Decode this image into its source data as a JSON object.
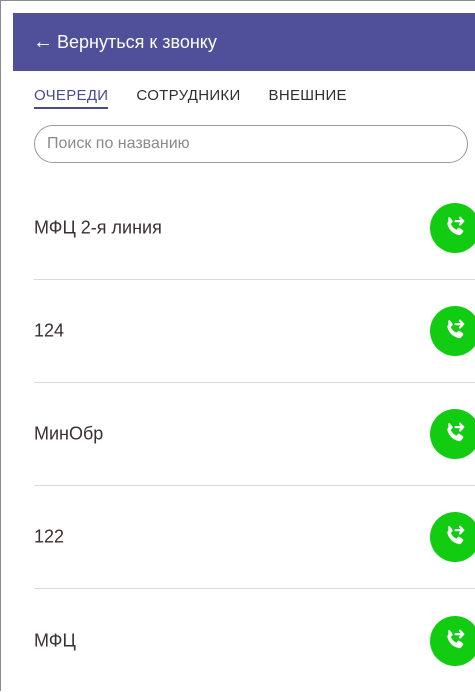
{
  "header": {
    "back_arrow": "←",
    "back_label": "Вернуться к звонку",
    "background_color": "#504f99"
  },
  "tabs": [
    {
      "label": "ОЧЕРЕДИ",
      "active": true
    },
    {
      "label": "СОТРУДНИКИ",
      "active": false
    },
    {
      "label": "ВНЕШНИЕ",
      "active": false
    }
  ],
  "search": {
    "placeholder": "Поиск по названию",
    "value": ""
  },
  "queues": [
    {
      "name": "МФЦ 2-я линия",
      "action_icon": "phone-transfer-icon"
    },
    {
      "name": "124",
      "action_icon": "phone-transfer-icon"
    },
    {
      "name": "МинОбр",
      "action_icon": "phone-transfer-icon"
    },
    {
      "name": "122",
      "action_icon": "phone-transfer-icon"
    },
    {
      "name": "МФЦ",
      "action_icon": "phone-transfer-icon"
    }
  ],
  "colors": {
    "call_button": "#12cc12",
    "active_tab": "#4a4a8f"
  }
}
